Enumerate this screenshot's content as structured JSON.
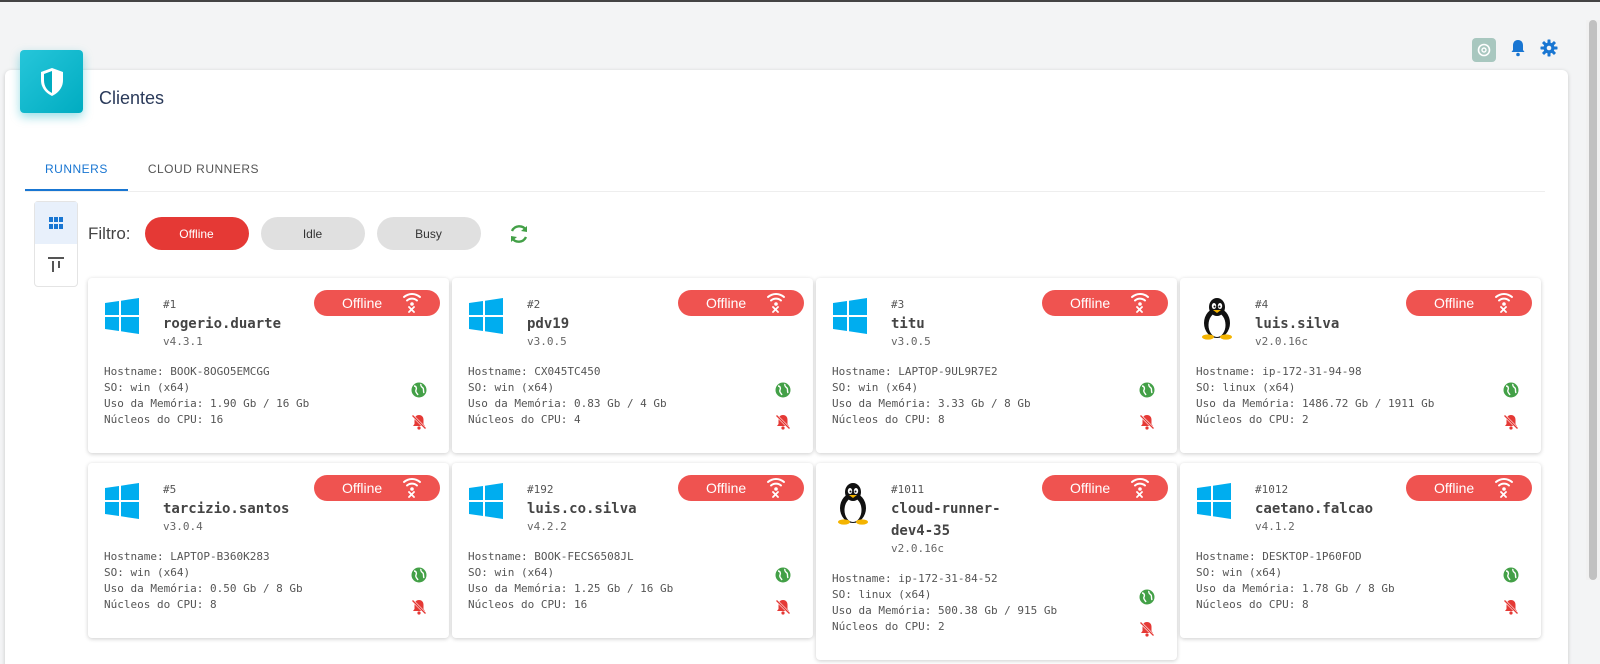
{
  "header": {
    "title": "Clientes"
  },
  "top_icons": [
    "chatgpt-icon",
    "bell-icon",
    "gear-icon"
  ],
  "tabs": [
    {
      "label": "RUNNERS",
      "active": true
    },
    {
      "label": "CLOUD RUNNERS",
      "active": false
    }
  ],
  "filter": {
    "label": "Filtro:",
    "chips": [
      {
        "label": "Offline",
        "active": true
      },
      {
        "label": "Idle",
        "active": false
      },
      {
        "label": "Busy",
        "active": false
      }
    ]
  },
  "colors": {
    "accent": "#1976d2",
    "offline": "#ef5350",
    "online": "#43a047",
    "brand": "#00acc1",
    "windows": "#00adef"
  },
  "runners": [
    {
      "id": "#1",
      "name": "rogerio.duarte",
      "version": "v4.3.1",
      "os_icon": "windows-icon",
      "status": "Offline",
      "hostname": "Hostname: BOOK-8OGO5EMCGG",
      "so": "SO: win (x64)",
      "memory": "Uso da Memória: 1.90 Gb / 16 Gb",
      "cpu": "Núcleos do CPU: 16"
    },
    {
      "id": "#2",
      "name": "pdv19",
      "version": "v3.0.5",
      "os_icon": "windows-icon",
      "status": "Offline",
      "hostname": "Hostname: CX045TC450",
      "so": "SO: win (x64)",
      "memory": "Uso da Memória: 0.83 Gb / 4 Gb",
      "cpu": "Núcleos do CPU: 4"
    },
    {
      "id": "#3",
      "name": "titu",
      "version": "v3.0.5",
      "os_icon": "windows-icon",
      "status": "Offline",
      "hostname": "Hostname: LAPTOP-9UL9R7E2",
      "so": "SO: win (x64)",
      "memory": "Uso da Memória: 3.33 Gb / 8 Gb",
      "cpu": "Núcleos do CPU: 8"
    },
    {
      "id": "#4",
      "name": "luis.silva",
      "version": "v2.0.16c",
      "os_icon": "linux-icon",
      "status": "Offline",
      "hostname": "Hostname: ip-172-31-94-98",
      "so": "SO: linux (x64)",
      "memory": "Uso da Memória: 1486.72 Gb / 1911 Gb",
      "cpu": "Núcleos do CPU: 2"
    },
    {
      "id": "#5",
      "name": "tarcizio.santos",
      "version": "v3.0.4",
      "os_icon": "windows-icon",
      "status": "Offline",
      "hostname": "Hostname: LAPTOP-B360K283",
      "so": "SO: win (x64)",
      "memory": "Uso da Memória: 0.50 Gb / 8 Gb",
      "cpu": "Núcleos do CPU: 8"
    },
    {
      "id": "#192",
      "name": "luis.co.silva",
      "version": "v4.2.2",
      "os_icon": "windows-icon",
      "status": "Offline",
      "hostname": "Hostname: BOOK-FECS6508JL",
      "so": "SO: win (x64)",
      "memory": "Uso da Memória: 1.25 Gb / 16 Gb",
      "cpu": "Núcleos do CPU: 16"
    },
    {
      "id": "#1011",
      "name": "cloud-runner-dev4-35",
      "version": "v2.0.16c",
      "os_icon": "linux-icon",
      "status": "Offline",
      "hostname": "Hostname: ip-172-31-84-52",
      "so": "SO: linux (x64)",
      "memory": "Uso da Memória: 500.38 Gb / 915 Gb",
      "cpu": "Núcleos do CPU: 2"
    },
    {
      "id": "#1012",
      "name": "caetano.falcao",
      "version": "v4.1.2",
      "os_icon": "windows-icon",
      "status": "Offline",
      "hostname": "Hostname: DESKTOP-1P60FOD",
      "so": "SO: win (x64)",
      "memory": "Uso da Memória: 1.78 Gb / 8 Gb",
      "cpu": "Núcleos do CPU: 8"
    }
  ]
}
